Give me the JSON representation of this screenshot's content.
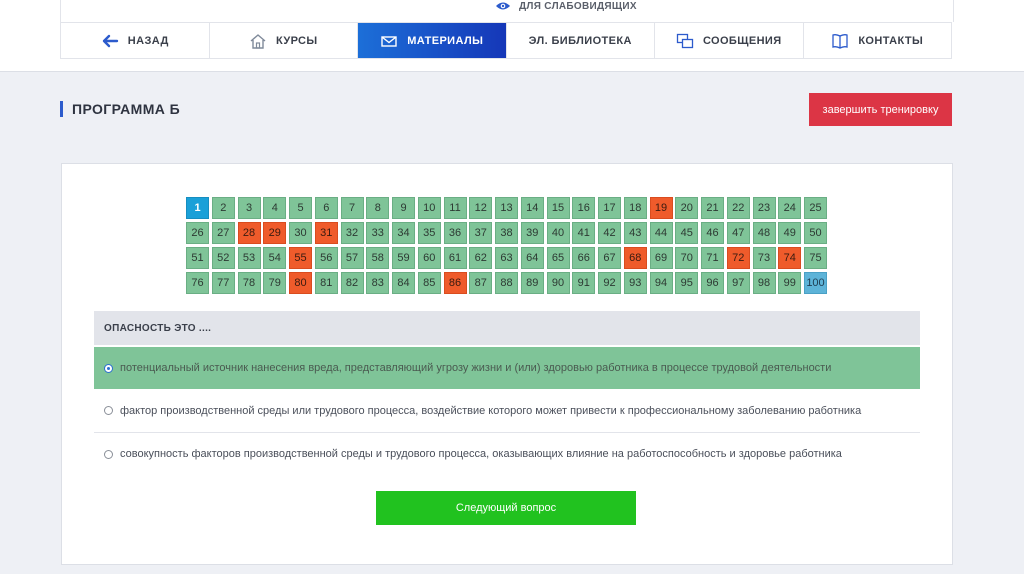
{
  "header": {
    "vision_link": "ДЛЯ СЛАБОВИДЯЩИХ",
    "nav": [
      {
        "label": "НАЗАД",
        "icon": "arrow-left-icon",
        "active": false
      },
      {
        "label": "КУРСЫ",
        "icon": "home-icon",
        "active": false
      },
      {
        "label": "МАТЕРИАЛЫ",
        "icon": "mail-icon",
        "active": true
      },
      {
        "label": "ЭЛ. БИБЛИОТЕКА",
        "icon": "",
        "active": false
      },
      {
        "label": "СООБЩЕНИЯ",
        "icon": "messages-icon",
        "active": false
      },
      {
        "label": "КОНТАКТЫ",
        "icon": "book-icon",
        "active": false
      }
    ]
  },
  "page": {
    "title": "ПРОГРАММА Б",
    "finish_button": "завершить тренировку"
  },
  "questions": {
    "count": 100,
    "current": 1,
    "wrong": [
      19,
      28,
      29,
      31,
      55,
      68,
      72,
      74,
      80,
      86
    ],
    "highlighted_last": 100
  },
  "question": {
    "text": "ОПАСНОСТЬ ЭТО ....",
    "answers": [
      {
        "text": "потенциальный источник нанесения вреда, представляющий угрозу жизни и (или) здоровью работника в процессе трудовой деятельности",
        "selected": true
      },
      {
        "text": "фактор производственной среды или трудового процесса, воздействие которого может привести к профессиональному заболеванию работника",
        "selected": false
      },
      {
        "text": "совокупность факторов производственной среды и трудового процесса, оказывающих влияние на работоспособность и здоровье работника",
        "selected": false
      }
    ],
    "next_button": "Следующий вопрос"
  },
  "colors": {
    "correct": "#7fc498",
    "wrong": "#ef5b2b",
    "current": "#1aa0d8",
    "finish": "#dc3545",
    "next": "#21c21f",
    "nav_active": "#1c6fd8"
  }
}
